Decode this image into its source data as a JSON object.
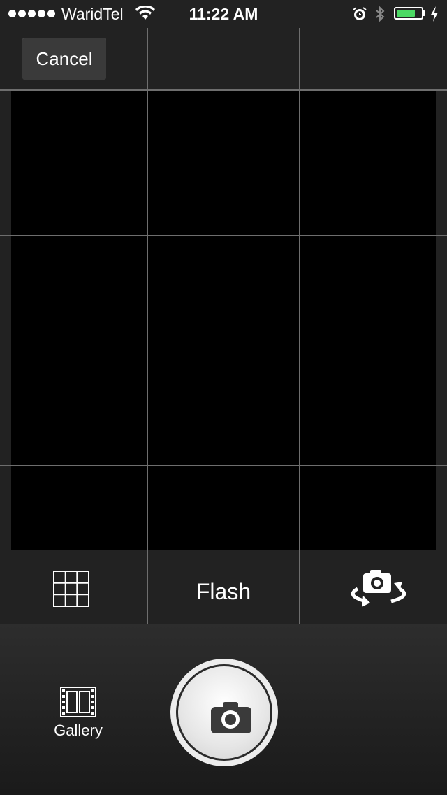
{
  "status_bar": {
    "carrier": "WaridTel",
    "time": "11:22 AM",
    "battery_color": "#4cd964"
  },
  "top_bar": {
    "cancel_label": "Cancel"
  },
  "controls": {
    "grid_icon": "grid-icon",
    "flash_label": "Flash",
    "switch_camera_icon": "switch-camera-icon"
  },
  "bottom_bar": {
    "gallery_label": "Gallery",
    "gallery_icon": "film-strip-icon",
    "shutter_icon": "camera-icon"
  }
}
